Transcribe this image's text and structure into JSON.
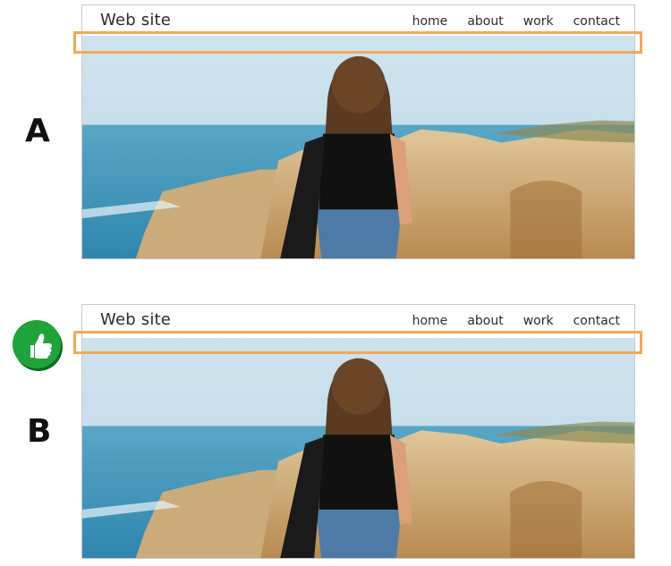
{
  "variants": [
    {
      "label": "A",
      "site_title": "Web site",
      "nav": [
        "home",
        "about",
        "work",
        "contact"
      ],
      "recommended": false
    },
    {
      "label": "B",
      "site_title": "Web site",
      "nav": [
        "home",
        "about",
        "work",
        "contact"
      ],
      "recommended": true
    }
  ],
  "colors": {
    "highlight": "#f4a85a",
    "badge": "#1fa33a",
    "text": "#2c2c2c"
  },
  "icons": {
    "badge": "thumbs-up-icon"
  }
}
